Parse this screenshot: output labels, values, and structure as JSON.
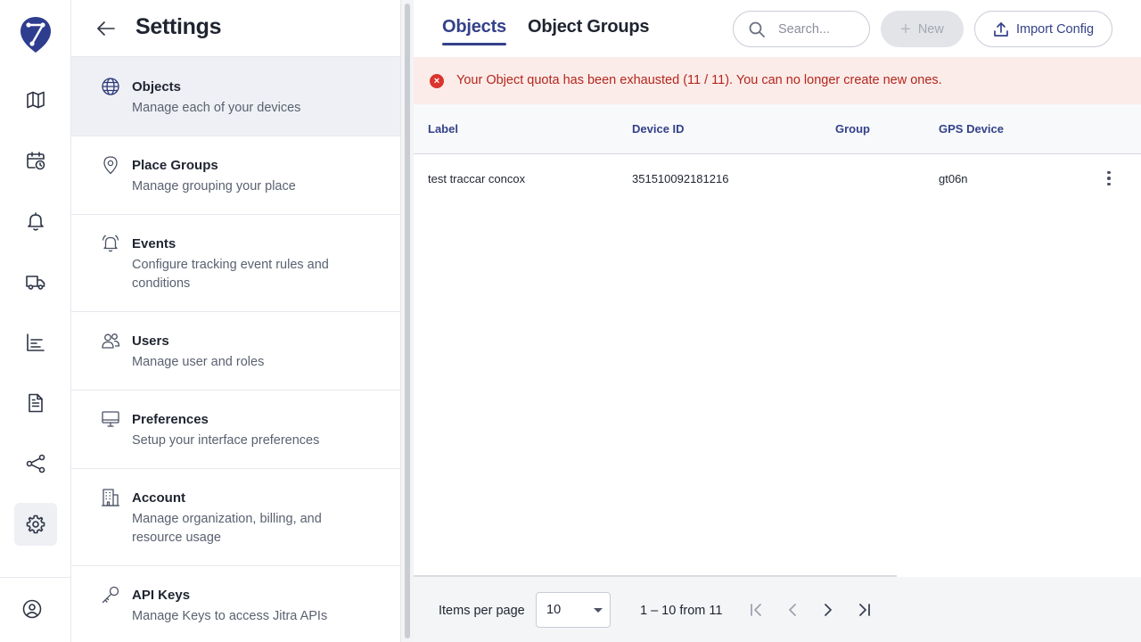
{
  "rail": {
    "items": [
      {
        "icon": "map-icon",
        "name": "Map"
      },
      {
        "icon": "calendar-clock-icon",
        "name": "History"
      },
      {
        "icon": "bell-icon",
        "name": "Notifications"
      },
      {
        "icon": "truck-icon",
        "name": "Vehicles"
      },
      {
        "icon": "bar-chart-icon",
        "name": "Reports"
      },
      {
        "icon": "document-icon",
        "name": "Documents"
      },
      {
        "icon": "share-icon",
        "name": "Share"
      },
      {
        "icon": "gear-icon",
        "name": "Settings",
        "active": true
      }
    ]
  },
  "settings": {
    "title": "Settings",
    "items": [
      {
        "title": "Objects",
        "desc": "Manage each of your devices",
        "icon": "globe-icon",
        "active": true
      },
      {
        "title": "Place Groups",
        "desc": "Manage grouping your place",
        "icon": "map-pin-icon"
      },
      {
        "title": "Events",
        "desc": "Configure tracking event rules and conditions",
        "icon": "bell-ring-icon"
      },
      {
        "title": "Users",
        "desc": "Manage user and roles",
        "icon": "users-icon"
      },
      {
        "title": "Preferences",
        "desc": "Setup your interface preferences",
        "icon": "monitor-icon"
      },
      {
        "title": "Account",
        "desc": "Manage organization, billing, and resource usage",
        "icon": "building-icon"
      },
      {
        "title": "API Keys",
        "desc": "Manage Keys to access Jitra APIs",
        "icon": "key-icon"
      }
    ]
  },
  "main": {
    "tabs": [
      {
        "label": "Objects",
        "active": true
      },
      {
        "label": "Object Groups",
        "active": false
      }
    ],
    "search_placeholder": "Search...",
    "new_label": "New",
    "import_label": "Import Config",
    "alert": "Your Object quota has been exhausted (11 / 11). You can no longer create new ones.",
    "table": {
      "columns": [
        "Label",
        "Device ID",
        "Group",
        "GPS Device"
      ],
      "rows": [
        [
          "test traccar concox",
          "351510092181216",
          "",
          "gt06n"
        ]
      ]
    },
    "footer": {
      "items_per_page_label": "Items per page",
      "items_per_page_value": "10",
      "range_text": "1 – 10 from 11"
    }
  },
  "colors": {
    "accent": "#34418a",
    "alert_bg": "#fcece9",
    "alert_text": "#b3261e",
    "alert_icon": "#d9352e",
    "active_item_bg": "#eef0f5"
  }
}
